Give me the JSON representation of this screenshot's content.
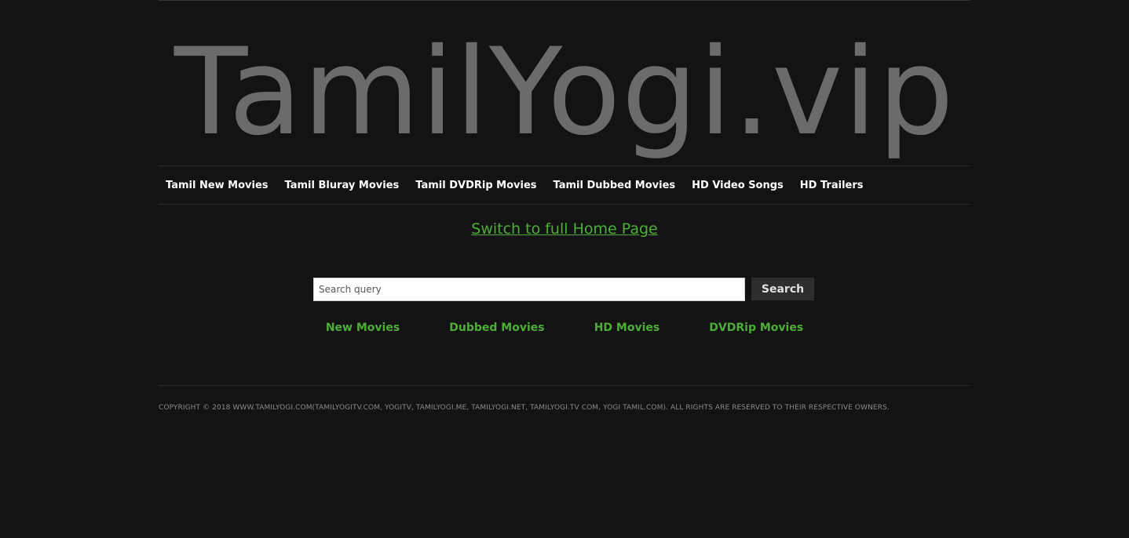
{
  "header": {
    "logo_text": "TamilYogi.vip"
  },
  "nav": {
    "items": [
      {
        "label": "Tamil New Movies"
      },
      {
        "label": "Tamil Bluray Movies"
      },
      {
        "label": "Tamil DVDRip Movies"
      },
      {
        "label": "Tamil Dubbed Movies"
      },
      {
        "label": "HD Video Songs"
      },
      {
        "label": "HD Trailers"
      }
    ]
  },
  "switch_link": {
    "label": "Switch to full Home Page"
  },
  "search": {
    "placeholder": "Search query",
    "value": "",
    "button_label": "Search"
  },
  "quick_links": {
    "items": [
      {
        "label": "New Movies"
      },
      {
        "label": "Dubbed Movies"
      },
      {
        "label": "HD Movies"
      },
      {
        "label": "DVDRip Movies"
      }
    ]
  },
  "footer": {
    "copyright": "Copyright © 2018 www.tamilyogi.com(tamilyogitv.com, yogitv, tamilyogi.me, tamilyogi.net, tamilyogi.tv com, yogi tamil.com). All rights are reserved to their respective owners."
  },
  "colors": {
    "background": "#131313",
    "logo": "#6b6b6b",
    "link_green": "#4cae38",
    "nav_text": "#ffffff"
  }
}
